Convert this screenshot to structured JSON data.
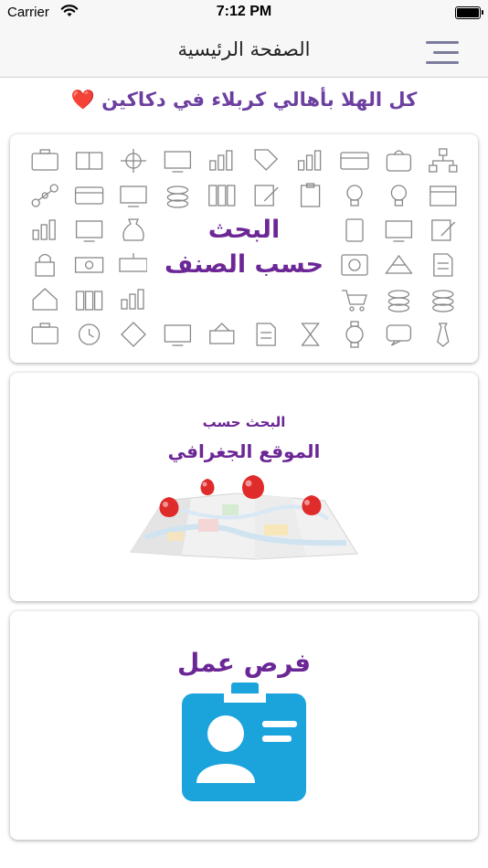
{
  "status_bar": {
    "carrier": "Carrier",
    "time": "7:12 PM",
    "icons": [
      "wifi-icon",
      "battery-icon"
    ]
  },
  "navbar": {
    "title": "الصفحة الرئيسية",
    "menu_icon": "hamburger-menu-icon"
  },
  "greeting": "كل الهلا بأهالي كربلاء في دكاكين ❤️",
  "cards": [
    {
      "title_line1": "البحث",
      "title_line2": "حسب الصنف",
      "icon": "category-icons-grid"
    },
    {
      "title_line1": "البحث حسب",
      "title_line2": "الموقع الجغرافي",
      "icon": "map-pins-icon"
    },
    {
      "title": "فرص عمل",
      "icon": "id-badge-icon"
    }
  ],
  "colors": {
    "accent": "#6c2796",
    "greeting": "#6c3fa0",
    "map_pin": "#e02b2b",
    "badge": "#1ba3dc",
    "icon_line": "#888888"
  }
}
